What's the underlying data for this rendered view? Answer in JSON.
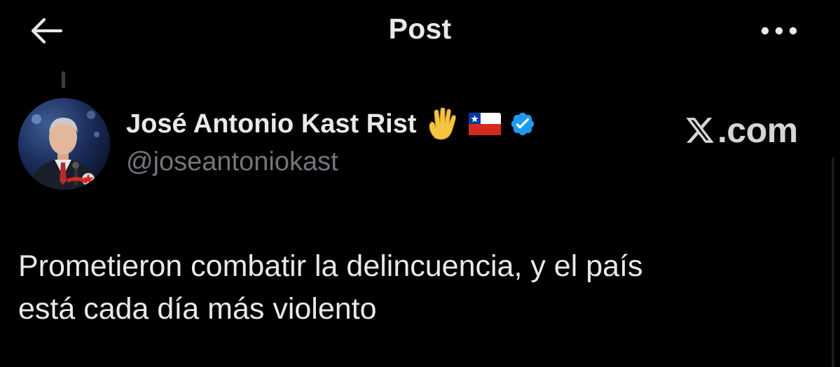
{
  "header": {
    "title": "Post",
    "back_icon": "arrow-left-icon",
    "more_icon": "more-dots-icon"
  },
  "post": {
    "author": {
      "name": "José Antonio Kast Rist",
      "handle": "@joseantoniokast",
      "badges": [
        "raised-hand-emoji",
        "chile-flag-emoji",
        "verified-badge-icon"
      ],
      "avatar": "profile-photo"
    },
    "text": "Prometieron combatir la delincuencia, y el país\nestá cada día más violento"
  },
  "watermark": {
    "text": ".com",
    "logo": "x-logo-icon"
  },
  "colors": {
    "background": "#000000",
    "primary_text": "#e7e9ea",
    "secondary_text": "#71767b",
    "verified_blue": "#1d9bf0"
  }
}
